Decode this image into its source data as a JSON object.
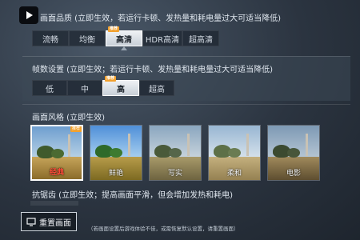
{
  "quality": {
    "heading": "画面品质 (立即生效，若运行卡顿、发热量和耗电量过大可适当降低)",
    "options": [
      {
        "label": "流畅",
        "selected": false,
        "tag": ""
      },
      {
        "label": "均衡",
        "selected": false,
        "tag": ""
      },
      {
        "label": "高清",
        "selected": true,
        "tag": "推荐"
      },
      {
        "label": "HDR高清",
        "selected": false,
        "tag": ""
      },
      {
        "label": "超高清",
        "selected": false,
        "tag": ""
      }
    ]
  },
  "frame_rate": {
    "heading": "帧数设置 (立即生效；若运行卡顿、发热量和耗电量过大可适当降低)",
    "options": [
      {
        "label": "低",
        "selected": false,
        "tag": ""
      },
      {
        "label": "中",
        "selected": false,
        "tag": ""
      },
      {
        "label": "高",
        "selected": true,
        "tag": "推荐"
      },
      {
        "label": "超高",
        "selected": false,
        "tag": ""
      }
    ]
  },
  "style": {
    "heading": "画面风格 (立即生效)",
    "options": [
      {
        "label": "经典",
        "selected": true,
        "tag": "推荐"
      },
      {
        "label": "鲜艳",
        "selected": false,
        "tag": ""
      },
      {
        "label": "写实",
        "selected": false,
        "tag": ""
      },
      {
        "label": "柔和",
        "selected": false,
        "tag": ""
      },
      {
        "label": "电影",
        "selected": false,
        "tag": ""
      }
    ]
  },
  "antialias": {
    "heading": "抗锯齿 (立即生效；提高画面平滑，但会增加发热和耗电)"
  },
  "footer": {
    "reset_label": "重置画面",
    "note": "（若画面设置后游戏体验不佳，或需恢复默认设置，请重置画面）"
  },
  "colors": {
    "accent_tag": "#f2a12e",
    "selected_caption": "#ff4b3a"
  },
  "icons": {
    "app_badge": "play-icon",
    "reset": "reset-screen-icon"
  }
}
